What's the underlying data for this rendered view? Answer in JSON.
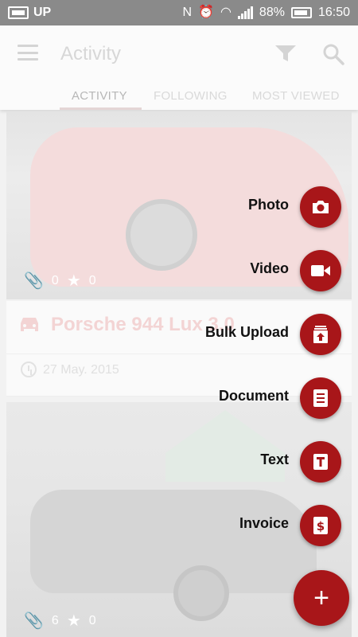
{
  "status_bar": {
    "carrier": "UP",
    "battery": "88%",
    "time": "16:50"
  },
  "app_bar": {
    "title": "Activity",
    "tabs": [
      {
        "label": "ACTIVITY",
        "active": true
      },
      {
        "label": "FOLLOWING",
        "active": false
      },
      {
        "label": "MOST VIEWED",
        "active": false
      }
    ]
  },
  "feed": {
    "post1": {
      "attachments": "0",
      "stars": "0",
      "title": "Porsche 944 Lux 3.0",
      "date": "27 May. 2015"
    },
    "post2": {
      "attachments": "6",
      "stars": "0"
    }
  },
  "speed_dial": {
    "items": [
      {
        "label": "Photo",
        "icon": "camera-icon"
      },
      {
        "label": "Video",
        "icon": "video-icon"
      },
      {
        "label": "Bulk Upload",
        "icon": "upload-icon"
      },
      {
        "label": "Document",
        "icon": "document-icon"
      },
      {
        "label": "Text",
        "icon": "text-icon"
      },
      {
        "label": "Invoice",
        "icon": "invoice-icon"
      }
    ],
    "fab_label": "+"
  },
  "colors": {
    "accent": "#a81619",
    "status_bar": "#8a8a8a",
    "app_bar": "#fbfbfb"
  }
}
